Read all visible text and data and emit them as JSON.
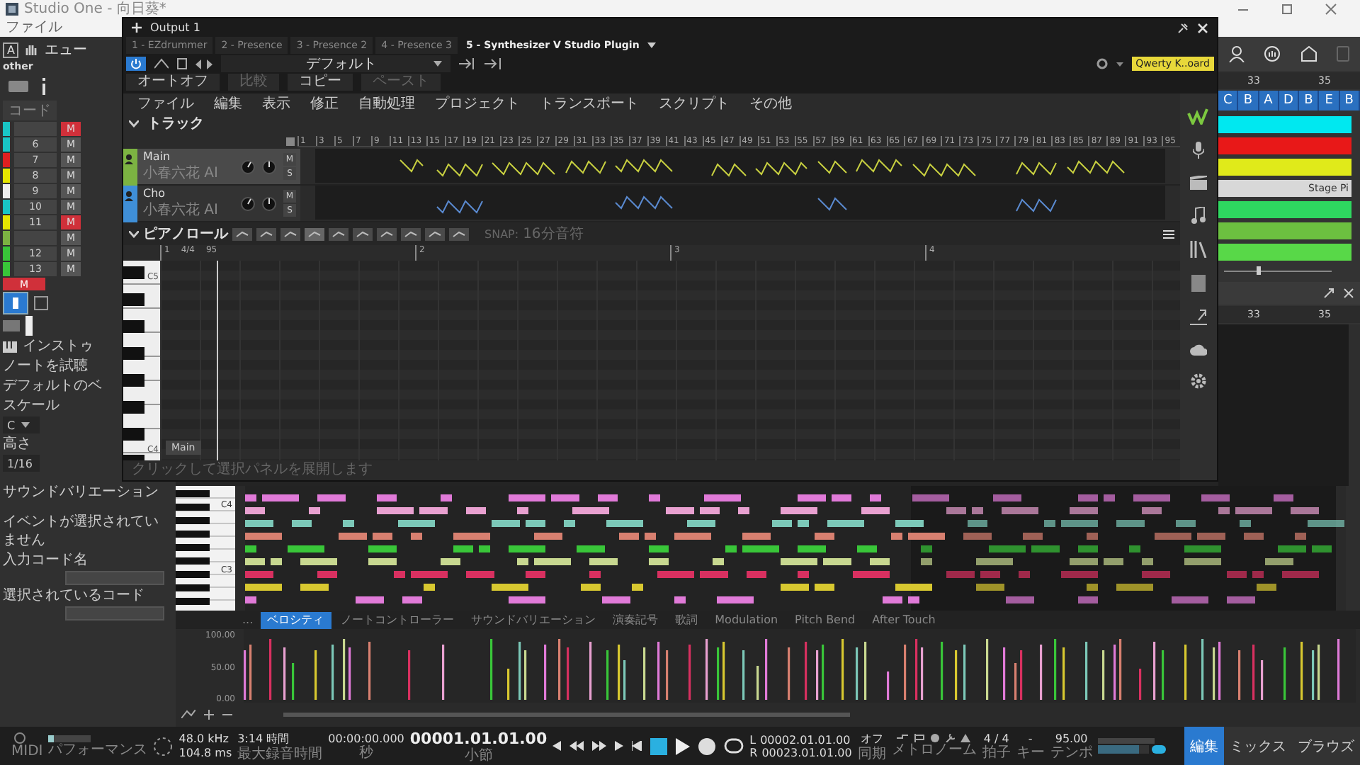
{
  "window": {
    "title": "Studio One - 向日葵*"
  },
  "host_menu": [
    "ファイル"
  ],
  "sidebar": {
    "instrument": "A",
    "name": "エュー",
    "tag": "other",
    "chord_label": "コード",
    "tracks": [
      {
        "color": "#19c6c6",
        "mute": "M",
        "muted": true
      },
      {
        "number": "6",
        "color": "#19c6c6",
        "mute": "M",
        "muted": false
      },
      {
        "number": "7",
        "color": "#e02020",
        "mute": "M",
        "muted": false
      },
      {
        "number": "8",
        "color": "#e6e600",
        "mute": "M",
        "muted": false
      },
      {
        "number": "9",
        "color": "#eeeeee",
        "mute": "M",
        "muted": false
      },
      {
        "number": "10",
        "color": "#19c6c6",
        "mute": "M",
        "muted": false
      },
      {
        "number": "11",
        "color": "#e6e600",
        "mute": "M",
        "muted": true
      },
      {
        "color": "#7cb342",
        "mute": "M",
        "muted": false
      },
      {
        "number": "12",
        "color": "#39c639",
        "mute": "M",
        "muted": false
      },
      {
        "number": "13",
        "color": "#39c639",
        "mute": "M",
        "muted": false
      }
    ],
    "master_mute": "M",
    "instrument_label": "インストゥ",
    "audition_label": "ノートを試聴",
    "default_label": "デフォルトのベ",
    "scale_label": "スケール",
    "scale": "C",
    "height_label": "高さ",
    "quantize": "1/16",
    "sound_variation_label": "サウンドバリエーション",
    "event_status": "イベントが選択されていません",
    "input_chord_label": "入力コード名",
    "selected_chord_label": "選択されているコード"
  },
  "plugin": {
    "title": "Output 1",
    "tabs": [
      {
        "label": "1 - EZdrummer",
        "selected": false
      },
      {
        "label": "2 - Presence",
        "selected": false
      },
      {
        "label": "3 - Presence 2",
        "selected": false
      },
      {
        "label": "4 - Presence 3",
        "selected": false
      },
      {
        "label": "5 - Synthesizer V Studio Plugin",
        "selected": true
      }
    ],
    "preset": "デフォルト",
    "auto_label": "オートオフ",
    "compare": "比較",
    "copy": "コピー",
    "paste": "ペースト",
    "keyboard_badge": "Qwerty K..oard",
    "menu": [
      "ファイル",
      "編集",
      "表示",
      "修正",
      "自動処理",
      "プロジェクト",
      "トランスポート",
      "スクリプト",
      "その他"
    ],
    "track_section": "トラック",
    "ruler": [
      "1",
      "3",
      "5",
      "7",
      "9",
      "11",
      "13",
      "15",
      "17",
      "19",
      "21",
      "23",
      "25",
      "27",
      "29",
      "31",
      "33",
      "35",
      "37",
      "39",
      "41",
      "43",
      "45",
      "47",
      "49",
      "51",
      "53",
      "55",
      "57",
      "59",
      "61",
      "63",
      "65",
      "67",
      "69",
      "71",
      "73",
      "75",
      "77",
      "79",
      "81",
      "83",
      "85",
      "87",
      "89",
      "91",
      "93",
      "95"
    ],
    "tracks": [
      {
        "name": "Main",
        "voice": "小春六花 AI",
        "color": "#7cb342",
        "selected": true,
        "mute": "M",
        "solo": "S"
      },
      {
        "name": "Cho",
        "voice": "小春六花 AI",
        "color": "#3f8fd8",
        "selected": false,
        "mute": "M",
        "solo": "S"
      }
    ],
    "piano_roll": {
      "title": "ピアノロール",
      "snap_label": "SNAP:",
      "snap": "16分音符",
      "ruler": [
        {
          "bar": "1",
          "signature": "4/4",
          "tempo": "95"
        },
        {
          "bar": "2"
        },
        {
          "bar": "3"
        },
        {
          "bar": "4"
        }
      ],
      "key_labels": [
        "C5",
        "C4"
      ],
      "track_tag": "Main",
      "hint": "クリックして選択パネルを展開します"
    }
  },
  "arrangement": {
    "ruler": [
      "33",
      "35"
    ],
    "chords": [
      "C",
      "B",
      "A",
      "D",
      "B",
      "E",
      "B"
    ],
    "lanes": [
      {
        "color": "#00e8f0"
      },
      {
        "color": "#e81818"
      },
      {
        "color": "#e0ea1a"
      },
      {
        "color": "#d8d8d8",
        "label": "Stage Pi"
      },
      {
        "color": "#2ed860"
      },
      {
        "color": "#6cc040"
      },
      {
        "color": "#58d848"
      }
    ],
    "zoom": {
      "level": 0.3
    },
    "editor_ruler": [
      "33",
      "35"
    ]
  },
  "editor": {
    "key_labels": [
      "C4",
      "C3"
    ],
    "more": "...",
    "tabs": [
      {
        "label": "ベロシティ",
        "selected": true
      },
      {
        "label": "ノートコントローラー",
        "selected": false
      },
      {
        "label": "サウンドバリエーション",
        "selected": false
      },
      {
        "label": "演奏記号",
        "selected": false
      },
      {
        "label": "歌詞",
        "selected": false
      },
      {
        "label": "Modulation",
        "selected": false
      },
      {
        "label": "Pitch Bend",
        "selected": false
      },
      {
        "label": "After Touch",
        "selected": false
      }
    ],
    "axis": [
      "100.00",
      "50.00",
      "0.00"
    ]
  },
  "transport": {
    "midi": "MIDI",
    "performance": "パフォーマンス",
    "sample_rate": "48.0 kHz",
    "latency": "104.8 ms",
    "record_time": "3:14 時間",
    "record_time_label": "最大録音時間",
    "seconds": "00:00:00.000",
    "seconds_label": "秒",
    "bars": "00001.01.01.00",
    "bars_label": "小節",
    "loop_l_label": "L",
    "loop_l": "00002.01.01.00",
    "loop_r_label": "R",
    "loop_r": "00023.01.01.00",
    "sync": "オフ",
    "sync_label": "同期",
    "metronome_label": "メトロノーム",
    "signature": "4 / 4",
    "signature_label": "拍子",
    "key": "-",
    "key_label": "キー",
    "tempo": "95.00",
    "tempo_label": "テンポ",
    "volume": {
      "level": 0.8
    },
    "pages": [
      {
        "label": "編集",
        "selected": true
      },
      {
        "label": "ミックス",
        "selected": false
      },
      {
        "label": "ブラウズ",
        "selected": false
      }
    ]
  }
}
